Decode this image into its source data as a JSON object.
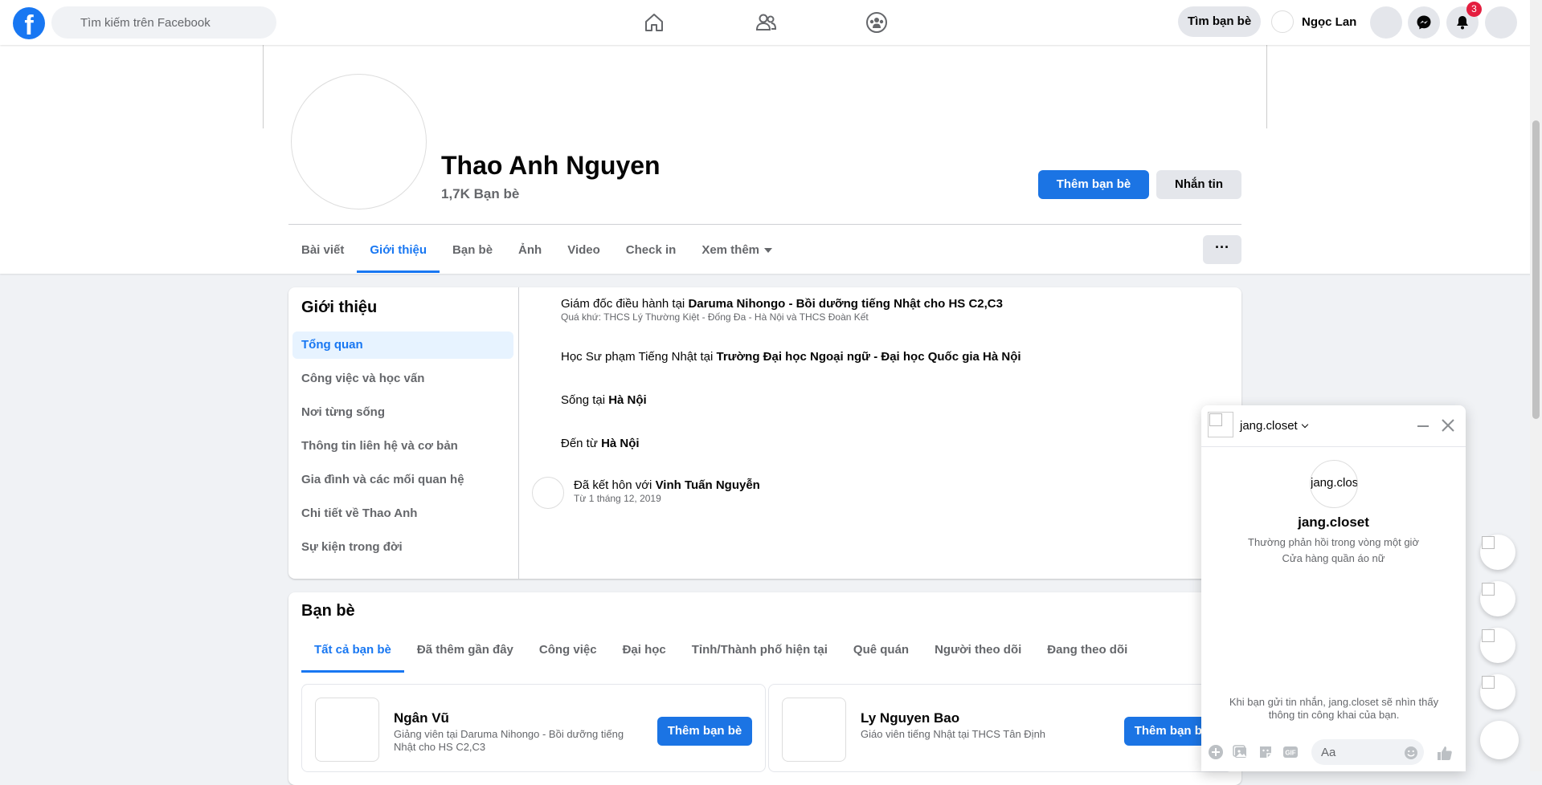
{
  "topbar": {
    "logo": "f",
    "search_placeholder": "Tìm kiếm trên Facebook",
    "nav_icons": [
      "home-icon",
      "friends-icon",
      "groups-icon"
    ],
    "find_friends_label": "Tìm bạn bè",
    "user_name": "Ngọc Lan",
    "notification_count": "3"
  },
  "profile": {
    "name": "Thao Anh Nguyen",
    "friends_count": "1,7K Bạn bè",
    "add_friend_label": "Thêm bạn bè",
    "message_label": "Nhắn tin",
    "more_label": "···",
    "tabs": [
      "Bài viết",
      "Giới thiệu",
      "Bạn bè",
      "Ảnh",
      "Video",
      "Check in",
      "Xem thêm"
    ],
    "active_tab": "Giới thiệu"
  },
  "intro": {
    "title": "Giới thiệu",
    "menu": [
      "Tổng quan",
      "Công việc và học vấn",
      "Nơi từng sống",
      "Thông tin liên hệ và cơ bản",
      "Gia đình và các mối quan hệ",
      "Chi tiết về Thao Anh",
      "Sự kiện trong đời"
    ],
    "work_prefix": "Giám đốc điều hành tại ",
    "work_place": "Daruma Nihongo - Bồi dưỡng tiếng Nhật cho HS C2,C3",
    "work_past": "Quá khứ: THCS Lý Thường Kiệt - Đống Đa - Hà Nội và THCS Đoàn Kết",
    "study_prefix": "Học Sư phạm Tiếng Nhật tại ",
    "study_place": "Trường Đại học Ngoại ngữ - Đại học Quốc gia Hà Nội",
    "lives_prefix": "Sống tại ",
    "lives_place": "Hà Nội",
    "from_prefix": "Đến từ ",
    "from_place": "Hà Nội",
    "married_prefix": "Đã kết hôn với ",
    "married_to": "Vinh Tuấn Nguyễn",
    "married_since": "Từ 1 tháng 12, 2019"
  },
  "friends": {
    "title": "Bạn bè",
    "tabs": [
      "Tất cả bạn bè",
      "Đã thêm gần đây",
      "Công việc",
      "Đại học",
      "Tỉnh/Thành phố hiện tại",
      "Quê quán",
      "Người theo dõi",
      "Đang theo dõi"
    ],
    "cards": [
      {
        "name": "Ngân Vũ",
        "desc": "Giảng viên tại Daruma Nihongo - Bồi dưỡng tiếng Nhật cho HS C2,C3",
        "button": "Thêm bạn bè"
      },
      {
        "name": "Ly Nguyen Bao",
        "desc": "Giáo viên tiếng Nhật tại THCS Tân Định",
        "button": "Thêm bạn bè"
      }
    ]
  },
  "chat": {
    "name": "jang.closet",
    "avatar_alt": "jang.clos",
    "title": "jang.closet",
    "response_time": "Thường phản hồi trong vòng một giờ",
    "category": "Cửa hàng quần áo nữ",
    "notice": "Khi bạn gửi tin nhắn, jang.closet sẽ nhìn thấy thông tin công khai của bạn.",
    "input_placeholder": "Aa"
  },
  "colors": {
    "brand_blue": "#1877f2",
    "button_blue": "#1b74e4",
    "badge_red": "#e41e3f",
    "page_bg": "#f0f2f5"
  }
}
